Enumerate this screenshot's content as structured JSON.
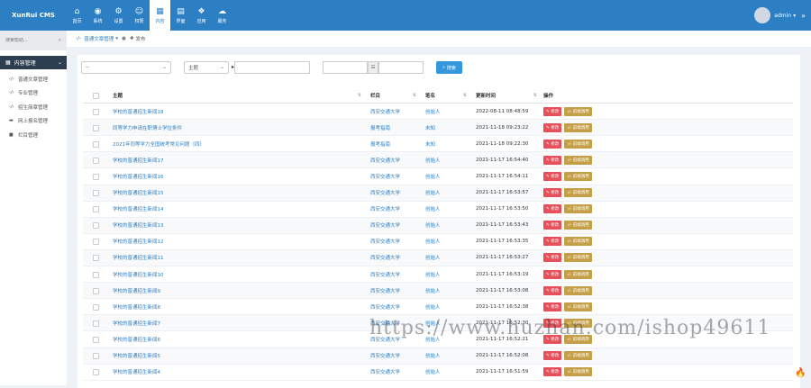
{
  "logo": "XunRui CMS",
  "nav": [
    {
      "icon": "⌂",
      "label": "首页"
    },
    {
      "icon": "◉",
      "label": "系统"
    },
    {
      "icon": "⚙",
      "label": "设置"
    },
    {
      "icon": "☺",
      "label": "权限"
    },
    {
      "icon": "▦",
      "label": "内容"
    },
    {
      "icon": "▤",
      "label": "界面"
    },
    {
      "icon": "❖",
      "label": "应用"
    },
    {
      "icon": "☁",
      "label": "服务"
    }
  ],
  "user": {
    "name": "admin",
    "chevron": "»",
    "caret": "▾"
  },
  "sidebar": {
    "search_placeholder": "搜索帮助...",
    "menu_title": "内容管理",
    "items": [
      {
        "icon": "‹/›",
        "label": "普通文章管理"
      },
      {
        "icon": "‹/›",
        "label": "专业管理"
      },
      {
        "icon": "‹/›",
        "label": "招生简章管理"
      },
      {
        "icon": "▬",
        "label": "网上报名管理"
      },
      {
        "icon": "■",
        "label": "栏目管理"
      }
    ]
  },
  "tabs": {
    "active": "普通文章管理",
    "active_caret": "▾",
    "sep": "●",
    "second": "发布"
  },
  "filters": {
    "select1": "--",
    "select2": "主题",
    "date_placeholder": "",
    "search_button": "搜索"
  },
  "table": {
    "columns": [
      "主题",
      "栏目",
      "笔名",
      "更新时间",
      "操作"
    ],
    "edit_label": "修改",
    "call_label": "前端调用",
    "rows": [
      {
        "title": "学校的普通招生新闻18",
        "column": "西安交通大学",
        "author": "创始人",
        "time": "2022-08-11 08:48:59"
      },
      {
        "title": "同等学力申请在职博士学位条件",
        "column": "报考指南",
        "author": "未知",
        "time": "2021-11-18 09:23:22"
      },
      {
        "title": "2021年同等学力全国统考常见问题（四）",
        "column": "报考指南",
        "author": "未知",
        "time": "2021-11-18 09:22:30"
      },
      {
        "title": "学校的普通招生新闻17",
        "column": "西安交通大学",
        "author": "创始人",
        "time": "2021-11-17 16:54:40"
      },
      {
        "title": "学校的普通招生新闻16",
        "column": "西安交通大学",
        "author": "创始人",
        "time": "2021-11-17 16:54:11"
      },
      {
        "title": "学校的普通招生新闻15",
        "column": "西安交通大学",
        "author": "创始人",
        "time": "2021-11-17 16:53:57"
      },
      {
        "title": "学校的普通招生新闻14",
        "column": "西安交通大学",
        "author": "创始人",
        "time": "2021-11-17 16:53:50"
      },
      {
        "title": "学校的普通招生新闻13",
        "column": "西安交通大学",
        "author": "创始人",
        "time": "2021-11-17 16:53:43"
      },
      {
        "title": "学校的普通招生新闻12",
        "column": "西安交通大学",
        "author": "创始人",
        "time": "2021-11-17 16:53:35"
      },
      {
        "title": "学校的普通招生新闻11",
        "column": "西安交通大学",
        "author": "创始人",
        "time": "2021-11-17 16:53:27"
      },
      {
        "title": "学校的普通招生新闻10",
        "column": "西安交通大学",
        "author": "创始人",
        "time": "2021-11-17 16:53:19"
      },
      {
        "title": "学校的普通招生新闻9",
        "column": "西安交通大学",
        "author": "创始人",
        "time": "2021-11-17 16:53:08"
      },
      {
        "title": "学校的普通招生新闻8",
        "column": "西安交通大学",
        "author": "创始人",
        "time": "2021-11-17 16:52:38"
      },
      {
        "title": "学校的普通招生新闻7",
        "column": "西安交通大学",
        "author": "创始人",
        "time": "2021-11-17 16:52:30"
      },
      {
        "title": "学校的普通招生新闻6",
        "column": "西安交通大学",
        "author": "创始人",
        "time": "2021-11-17 16:52:21"
      },
      {
        "title": "学校的普通招生新闻5",
        "column": "西安交通大学",
        "author": "创始人",
        "time": "2021-11-17 16:52:08"
      },
      {
        "title": "学校的普通招生新闻4",
        "column": "西安交通大学",
        "author": "创始人",
        "time": "2021-11-17 16:51:59"
      }
    ]
  },
  "watermark": "https://www.huzhan.com/ishop49611",
  "colors": {
    "primary": "#2d7fc3",
    "sidebar_active": "#2d3e50",
    "edit": "#e7505a",
    "call": "#c49f47",
    "search": "#3598dc"
  }
}
